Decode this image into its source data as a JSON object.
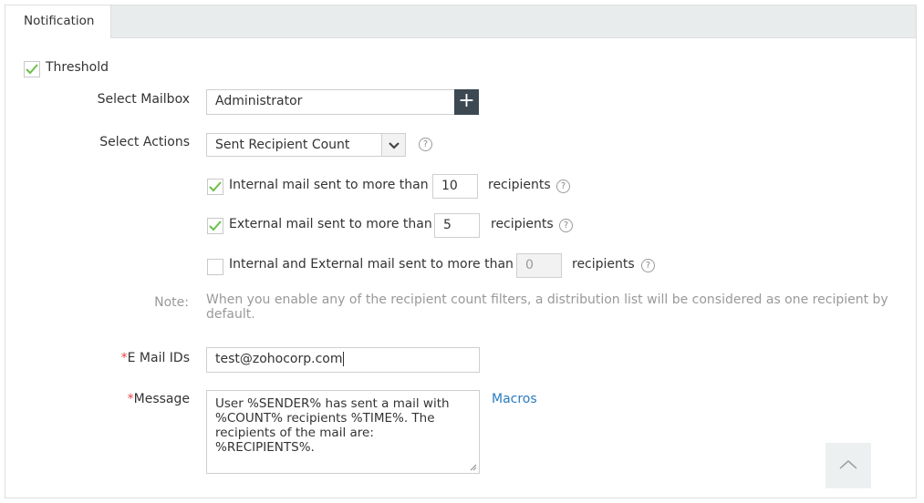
{
  "tabs": [
    {
      "label": "Notification",
      "active": true
    }
  ],
  "threshold": {
    "label": "Threshold",
    "checked": true
  },
  "select_mailbox": {
    "label": "Select Mailbox",
    "value": "Administrator",
    "add_icon": "plus-icon"
  },
  "select_actions": {
    "label": "Select Actions",
    "value": "Sent Recipient Count",
    "help_icon": "?"
  },
  "filters": [
    {
      "label": "Internal mail sent to more than",
      "value": "10",
      "suffix": "recipients",
      "checked": true,
      "disabled": false
    },
    {
      "label": "External mail sent to more than",
      "value": "5",
      "suffix": "recipients",
      "checked": true,
      "disabled": false
    },
    {
      "label": "Internal and External mail sent to more than",
      "value": "0",
      "suffix": "recipients",
      "checked": false,
      "disabled": true
    }
  ],
  "note": {
    "label": "Note:",
    "text": "When you enable any of the recipient count filters, a distribution list will be considered as one recipient by default."
  },
  "email_ids": {
    "required_mark": "*",
    "label": "E Mail IDs",
    "value": "test@zohocorp.com"
  },
  "message": {
    "required_mark": "*",
    "label": "Message",
    "value": "User %SENDER% has sent a mail with %COUNT% recipients %TIME%. The recipients of the mail are: %RECIPIENTS%.",
    "macros_link": "Macros"
  },
  "help_glyph": "?",
  "colors": {
    "accent_link": "#2a7bbf",
    "required": "#e8434a",
    "check": "#6cbf4a",
    "add_button": "#3c4852"
  }
}
